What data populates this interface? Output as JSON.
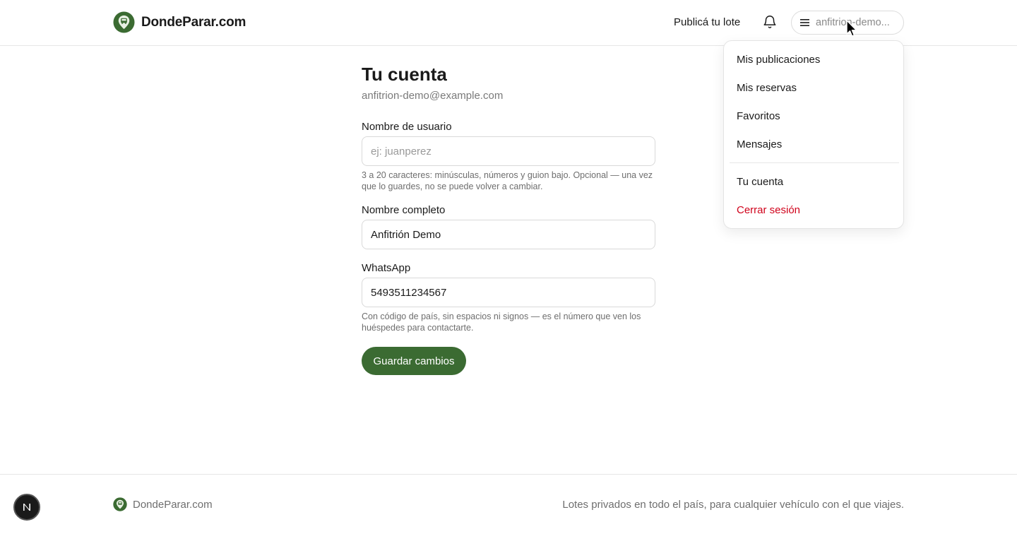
{
  "header": {
    "brand_name": "DondeParar.com",
    "publish_label": "Publicá tu lote",
    "user_pill_text": "anfitrion-demo..."
  },
  "dropdown": {
    "items": [
      {
        "label": "Mis publicaciones"
      },
      {
        "label": "Mis reservas"
      },
      {
        "label": "Favoritos"
      },
      {
        "label": "Mensajes"
      }
    ],
    "account_label": "Tu cuenta",
    "logout_label": "Cerrar sesión"
  },
  "main": {
    "title": "Tu cuenta",
    "email": "anfitrion-demo@example.com",
    "username": {
      "label": "Nombre de usuario",
      "placeholder": "ej: juanperez",
      "value": "",
      "help": "3 a 20 caracteres: minúsculas, números y guion bajo. Opcional — una vez que lo guardes, no se puede volver a cambiar."
    },
    "full_name": {
      "label": "Nombre completo",
      "value": "Anfitrión Demo"
    },
    "whatsapp": {
      "label": "WhatsApp",
      "value": "5493511234567",
      "help": "Con código de país, sin espacios ni signos — es el número que ven los huéspedes para contactarte."
    },
    "save_label": "Guardar cambios"
  },
  "footer": {
    "brand_name": "DondeParar.com",
    "tagline": "Lotes privados en todo el país, para cualquier vehículo con el que viajes."
  },
  "colors": {
    "brand_green": "#3b6b32",
    "logout_red": "#d0021b"
  },
  "icons": {
    "logo": "location-pin-van-icon",
    "bell": "bell-icon",
    "menu": "hamburger-icon",
    "cursor": "mouse-pointer-icon",
    "badge": "n-letter-icon"
  }
}
